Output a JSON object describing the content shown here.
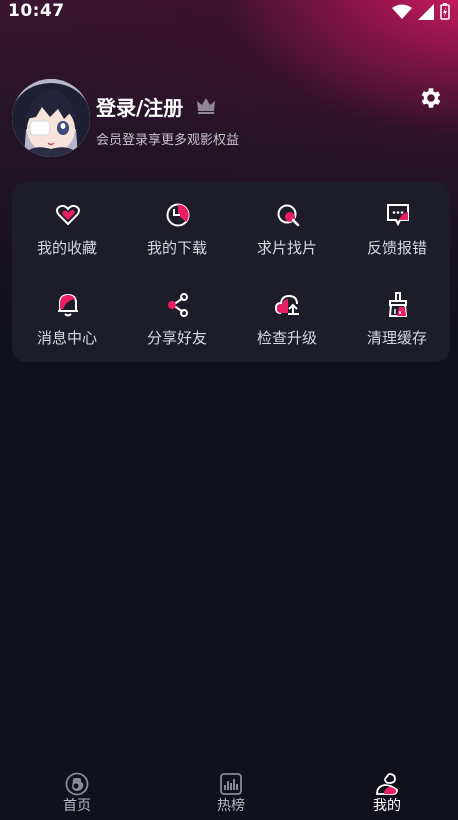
{
  "status_bar": {
    "time": "10:47"
  },
  "profile": {
    "title": "登录/注册",
    "subtitle": "会员登录享更多观影权益"
  },
  "menu": {
    "items": [
      {
        "label": "我的收藏",
        "icon": "heart-icon"
      },
      {
        "label": "我的下载",
        "icon": "download-icon"
      },
      {
        "label": "求片找片",
        "icon": "search-film-icon"
      },
      {
        "label": "反馈报错",
        "icon": "feedback-icon"
      },
      {
        "label": "消息中心",
        "icon": "bell-icon"
      },
      {
        "label": "分享好友",
        "icon": "share-icon"
      },
      {
        "label": "检查升级",
        "icon": "upgrade-cloud-icon"
      },
      {
        "label": "清理缓存",
        "icon": "broom-icon"
      }
    ]
  },
  "bottom_nav": {
    "items": [
      {
        "label": "首页",
        "icon": "home-icon"
      },
      {
        "label": "热榜",
        "icon": "chart-icon"
      },
      {
        "label": "我的",
        "icon": "profile-icon"
      }
    ],
    "active_index": 2
  },
  "colors": {
    "accent": "#e91e63",
    "background": "#11111c",
    "card": "#1c1d29"
  }
}
